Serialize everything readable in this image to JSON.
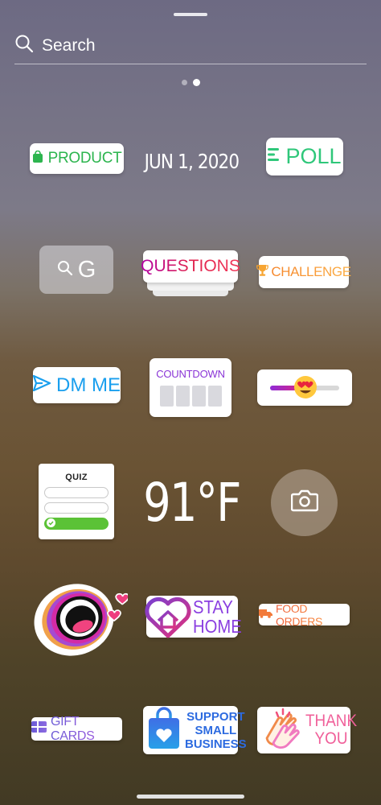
{
  "search": {
    "placeholder": "Search"
  },
  "pager": {
    "count": 2,
    "active": 2
  },
  "stickers": {
    "product": "PRODUCT",
    "date": "JUN 1, 2020",
    "poll": "POLL",
    "gif_search": "G",
    "questions": "QUESTIONS",
    "challenge": "CHALLENGE",
    "dm_me": "DM ME",
    "countdown": "COUNTDOWN",
    "quiz": "QUIZ",
    "temperature": "91°F",
    "stay": "STAY",
    "home": "HOME",
    "food_orders": "FOOD ORDERS",
    "gift_cards": "GIFT CARDS",
    "support": "SUPPORT",
    "small": "SMALL",
    "business": "BUSINESS",
    "thank": "THANK",
    "you": "YOU"
  },
  "colors": {
    "product_green": "#2db54f",
    "poll_green": "#2fc77a",
    "questions_magenta": "#d4006f",
    "dm_blue": "#1a9fee",
    "countdown_purple": "#8a35d6",
    "quiz_green": "#5bc236"
  }
}
